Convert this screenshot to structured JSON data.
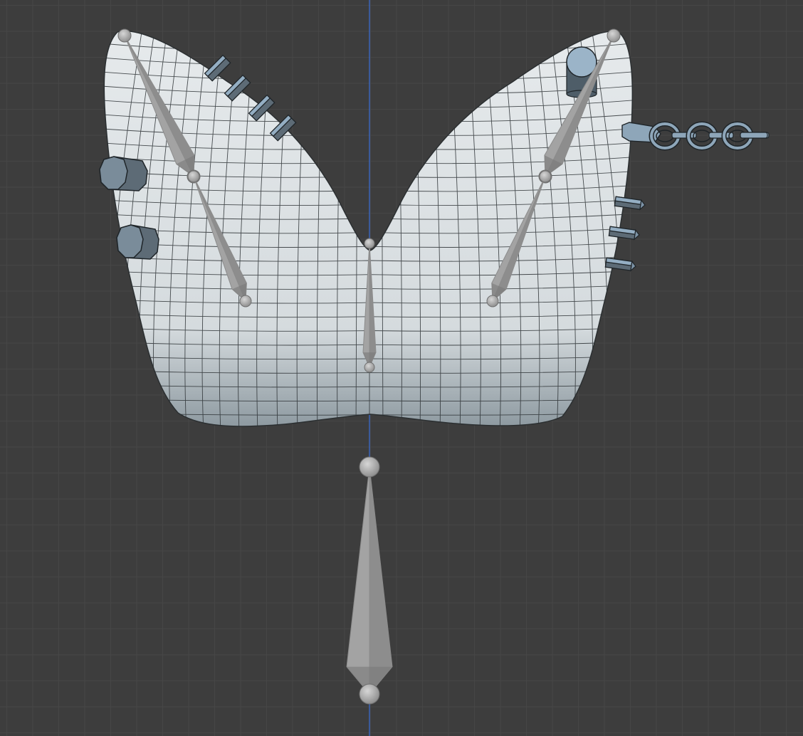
{
  "viewport": {
    "background": "#3d3d3d",
    "grid_color": "#464646",
    "axis_color": "#3a6fd8",
    "mesh_color": "#dfe4e7",
    "mesh_shadow_color": "#8e9aa1",
    "bone_color": "#9b9b9b",
    "accessory_color": "#7d93a6"
  },
  "scene": {
    "model": "shirt-mesh",
    "armature": {
      "bones": [
        "upper-left-bone",
        "lower-left-bone",
        "upper-right-bone",
        "lower-right-bone",
        "center-bone",
        "root-bone"
      ]
    },
    "accessories": {
      "left_studs": 4,
      "left_buttons": 2,
      "right_studs": 3,
      "chain_links": 3
    }
  }
}
